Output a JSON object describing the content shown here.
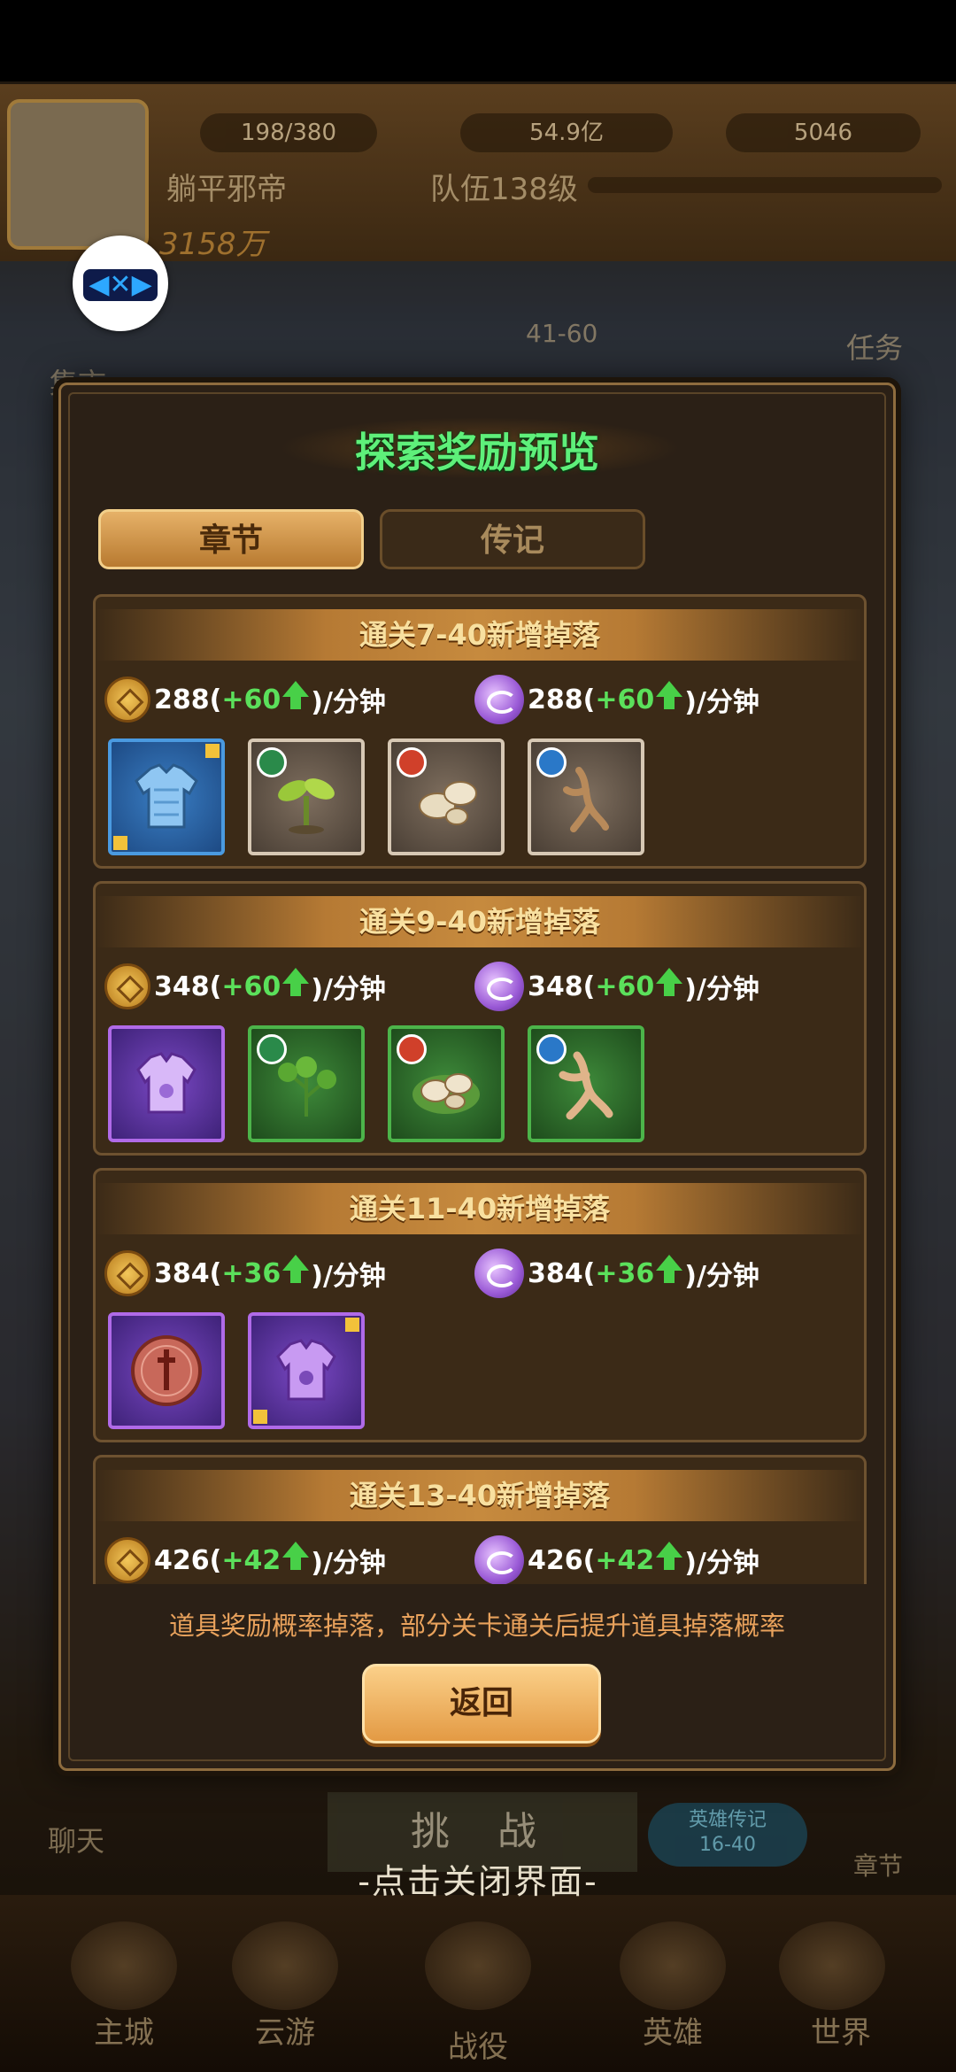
{
  "background": {
    "resources": [
      "198/380",
      "54.9亿",
      "5046"
    ],
    "player_name": "躺平邪帝",
    "team_level": "队伍138级",
    "power": "3158万",
    "labels": {
      "market": "集市",
      "stage": "41-60",
      "task": "任务",
      "chat": "聊天",
      "chapter": "章节"
    },
    "challenge": "挑 战",
    "hero_bio": {
      "title": "英雄传记",
      "range": "16-40"
    },
    "nav": [
      "主城",
      "云游",
      "战役",
      "英雄",
      "世界"
    ]
  },
  "close_hint": "-点击关闭界面-",
  "modal": {
    "title": "探索奖励预览",
    "tabs": [
      "章节",
      "传记"
    ],
    "active_tab": "章节",
    "sections": [
      {
        "heading": "通关7-40新增掉落",
        "gold": {
          "base": "288(",
          "bonus": "+60",
          "suffix": ")/分钟"
        },
        "exp": {
          "base": "288(",
          "bonus": "+60",
          "suffix": ")/分钟"
        },
        "items": [
          "armor-blue",
          "sprout",
          "seeds",
          "ginseng"
        ]
      },
      {
        "heading": "通关9-40新增掉落",
        "gold": {
          "base": "348(",
          "bonus": "+60",
          "suffix": ")/分钟"
        },
        "exp": {
          "base": "348(",
          "bonus": "+60",
          "suffix": ")/分钟"
        },
        "items": [
          "armor-purple",
          "herb",
          "seeds",
          "ginseng"
        ]
      },
      {
        "heading": "通关11-40新增掉落",
        "gold": {
          "base": "384(",
          "bonus": "+36",
          "suffix": ")/分钟"
        },
        "exp": {
          "base": "384(",
          "bonus": "+36",
          "suffix": ")/分钟"
        },
        "items": [
          "sword-token",
          "armor-purple"
        ]
      },
      {
        "heading": "通关13-40新增掉落",
        "gold": {
          "base": "426(",
          "bonus": "+42",
          "suffix": ")/分钟"
        },
        "exp": {
          "base": "426(",
          "bonus": "+42",
          "suffix": ")/分钟"
        },
        "items": []
      }
    ],
    "footer_note": "道具奖励概率掉落，部分关卡通关后提升道具掉落概率",
    "back_label": "返回"
  },
  "colors": {
    "title_green": "#5ef07a",
    "bonus_green": "#5be05b",
    "note_orange": "#e9a25c",
    "panel_bg": "#2b2016"
  }
}
